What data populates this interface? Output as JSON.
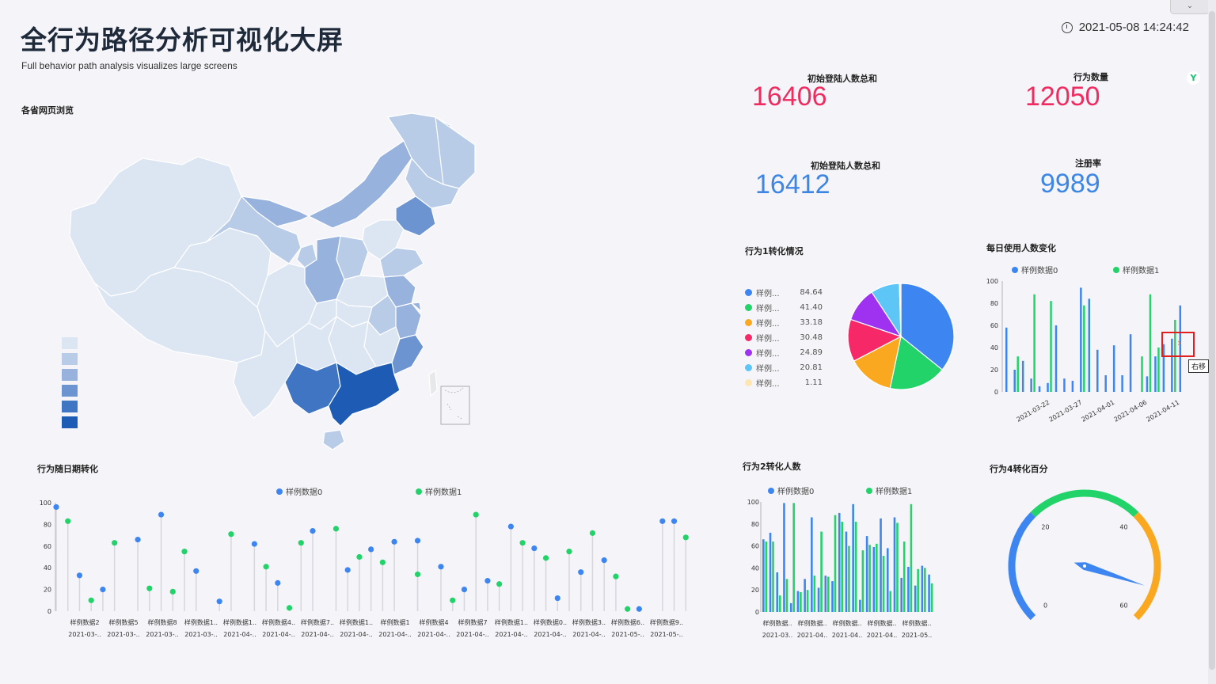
{
  "header": {
    "title": "全行为路径分析可视化大屏",
    "subtitle": "Full behavior path analysis visualizes large screens",
    "datetime": "2021-05-08 14:24:42",
    "clock_icon": "clock-icon"
  },
  "map": {
    "title": "各省网页浏览",
    "legend_colors": [
      "#dce6f3",
      "#b8cce8",
      "#97b2dd",
      "#6c94d0",
      "#3f75c2",
      "#1e5bb5"
    ]
  },
  "kpis": [
    {
      "label": "初始登陆人数总和",
      "value": "16406",
      "color": "#ef2b5f"
    },
    {
      "label": "行为数量",
      "value": "12050",
      "color": "#ef2b5f"
    },
    {
      "label": "初始登陆人数总和",
      "value": "16412",
      "color": "#3d86e4"
    },
    {
      "label": "注册率",
      "value": "9989",
      "color": "#3d86e4"
    }
  ],
  "pie": {
    "title": "行为1转化情况",
    "chart_data": {
      "type": "pie",
      "slices": [
        {
          "name": "样例...",
          "value": 84.64,
          "color": "#3d86f2"
        },
        {
          "name": "样例...",
          "value": 41.4,
          "color": "#22d36a"
        },
        {
          "name": "样例...",
          "value": 33.18,
          "color": "#fba821"
        },
        {
          "name": "样例...",
          "value": 30.48,
          "color": "#f72867"
        },
        {
          "name": "样例...",
          "value": 24.89,
          "color": "#9e32f0"
        },
        {
          "name": "样例...",
          "value": 20.81,
          "color": "#5ec6f6"
        },
        {
          "name": "样例...",
          "value": 1.11,
          "color": "#fde6b2"
        }
      ]
    },
    "value_labels": [
      "84.64",
      "41.40",
      "33.18",
      "30.48",
      "24.89",
      "20.81",
      "1.11"
    ]
  },
  "daily": {
    "title": "每日使用人数变化",
    "series_names": [
      "样例数据0",
      "样例数据1"
    ],
    "tooltip": "右移",
    "chart_data": {
      "type": "bar",
      "ylim": [
        0,
        100
      ],
      "yticks": [
        "100",
        "80",
        "60",
        "40",
        "20",
        "0"
      ],
      "xticks": [
        "2021-03-22",
        "2021-03-27",
        "2021-04-01",
        "2021-04-06",
        "2021-04-11"
      ],
      "series": [
        {
          "name": "样例数据0",
          "color": "#3d86f2",
          "values": [
            58,
            20,
            28,
            12,
            5,
            8,
            60,
            12,
            10,
            94,
            84,
            38,
            15,
            42,
            15,
            52,
            0,
            14,
            32,
            43,
            48,
            78
          ]
        },
        {
          "name": "样例数据1",
          "color": "#22d36a",
          "values": [
            0,
            32,
            0,
            88,
            0,
            82,
            0,
            0,
            0,
            78,
            0,
            0,
            0,
            0,
            0,
            0,
            32,
            88,
            40,
            0,
            65,
            0
          ]
        }
      ]
    }
  },
  "scatter": {
    "title": "行为随日期转化",
    "series_names": [
      "样例数据0",
      "样例数据1"
    ],
    "chart_data": {
      "type": "scatter",
      "ylim": [
        0,
        100
      ],
      "yticks": [
        "100",
        "80",
        "60",
        "40",
        "20",
        "0"
      ],
      "xticks_row1": [
        "样例数据2",
        "样例数据5",
        "样例数据8",
        "样例数据1..",
        "样例数据1..",
        "样例数据4..",
        "样例数据7..",
        "样例数据1..",
        "样例数据1",
        "样例数据4",
        "样例数据7",
        "样例数据1..",
        "样例数据0..",
        "样例数据3..",
        "样例数据6..",
        "样例数据9.."
      ],
      "xticks_row2": [
        "2021-03-..",
        "2021-03-..",
        "2021-03-..",
        "2021-03-..",
        "2021-04-..",
        "2021-04-..",
        "2021-04-..",
        "2021-04-..",
        "2021-04-..",
        "2021-04-..",
        "2021-04-..",
        "2021-04-..",
        "2021-04-..",
        "2021-04-..",
        "2021-05-..",
        "2021-05-.."
      ],
      "series": [
        {
          "name": "样例数据0",
          "color": "#3d86f2",
          "values": [
            96,
            null,
            33,
            null,
            20,
            null,
            null,
            66,
            null,
            89,
            null,
            null,
            37,
            null,
            9,
            null,
            null,
            62,
            null,
            26,
            null,
            null,
            74,
            null,
            null,
            38,
            null,
            57,
            null,
            64,
            null,
            65,
            null,
            41,
            null,
            20,
            null,
            28,
            null,
            78,
            null,
            58,
            null,
            12,
            null,
            36,
            null,
            47,
            null,
            null,
            2,
            null,
            83,
            83,
            null
          ]
        },
        {
          "name": "样例数据1",
          "color": "#22d36a",
          "values": [
            null,
            83,
            null,
            10,
            null,
            63,
            null,
            null,
            21,
            null,
            18,
            55,
            null,
            null,
            null,
            71,
            null,
            null,
            41,
            null,
            3,
            63,
            null,
            null,
            76,
            null,
            50,
            null,
            45,
            null,
            null,
            34,
            null,
            null,
            10,
            null,
            89,
            null,
            25,
            null,
            63,
            null,
            49,
            null,
            55,
            null,
            72,
            null,
            32,
            2,
            null,
            null,
            null,
            null,
            68,
            89
          ]
        }
      ]
    }
  },
  "bar2": {
    "title": "行为2转化人数",
    "series_names": [
      "样例数据0",
      "样例数据1"
    ],
    "chart_data": {
      "type": "bar",
      "ylim": [
        0,
        100
      ],
      "yticks": [
        "100",
        "80",
        "60",
        "40",
        "20",
        "0"
      ],
      "xticks_row1": [
        "样例数据..",
        "样例数据..",
        "样例数据..",
        "样例数据..",
        "样例数据.."
      ],
      "xticks_row2": [
        "2021-03..",
        "2021-04..",
        "2021-04..",
        "2021-04..",
        "2021-05.."
      ],
      "series": [
        {
          "name": "样例数据0",
          "color": "#3d86f2",
          "values": [
            66,
            72,
            36,
            99,
            8,
            19,
            30,
            86,
            22,
            33,
            28,
            90,
            73,
            98,
            11,
            69,
            59,
            85,
            58,
            86,
            31,
            41,
            24,
            42,
            34
          ]
        },
        {
          "name": "样例数据1",
          "color": "#22d36a",
          "values": [
            64,
            64,
            15,
            30,
            99,
            18,
            20,
            33,
            73,
            32,
            88,
            82,
            60,
            82,
            56,
            61,
            62,
            51,
            19,
            81,
            64,
            98,
            39,
            40,
            26
          ]
        }
      ]
    }
  },
  "gauge": {
    "title": "行为4转化百分",
    "chart_data": {
      "type": "gauge",
      "min": 0,
      "max": 60,
      "ticks": [
        "0",
        "20",
        "40",
        "60"
      ],
      "value": 54
    }
  }
}
